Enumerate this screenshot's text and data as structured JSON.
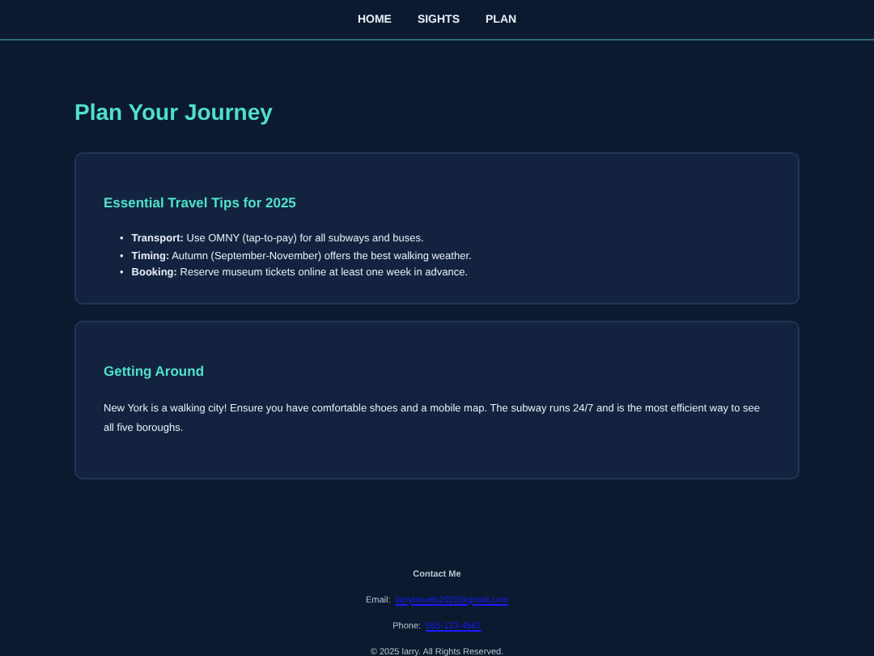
{
  "nav": [
    {
      "label": "HOME"
    },
    {
      "label": "SIGHTS"
    },
    {
      "label": "PLAN"
    }
  ],
  "title": "Plan Your Journey",
  "cards": [
    {
      "kind": "list",
      "heading": "Essential Travel Tips for 2025",
      "items": [
        {
          "marker": "•",
          "term": "Transport:",
          "text": "Use OMNY (tap-to-pay) for all subways and buses."
        },
        {
          "marker": "•",
          "term": "Timing:",
          "text": "Autumn (September-November) offers the best walking weather."
        },
        {
          "marker": "•",
          "term": "Booking:",
          "text": "Reserve museum tickets online at least one week in advance."
        }
      ]
    },
    {
      "kind": "text",
      "heading": "Getting Around",
      "text": "New York is a walking city! Ensure you have comfortable shoes and a mobile map. The subway runs 24/7 and is the most efficient way to see all five boroughs."
    }
  ],
  "footer": {
    "heading": "Contact Me",
    "email_label": "Email:",
    "email": "larrytravels2025@gmail.com",
    "phone_label": "Phone:",
    "phone": "555-123-4567",
    "copyright": "© 2025 larry. All Rights Reserved."
  }
}
